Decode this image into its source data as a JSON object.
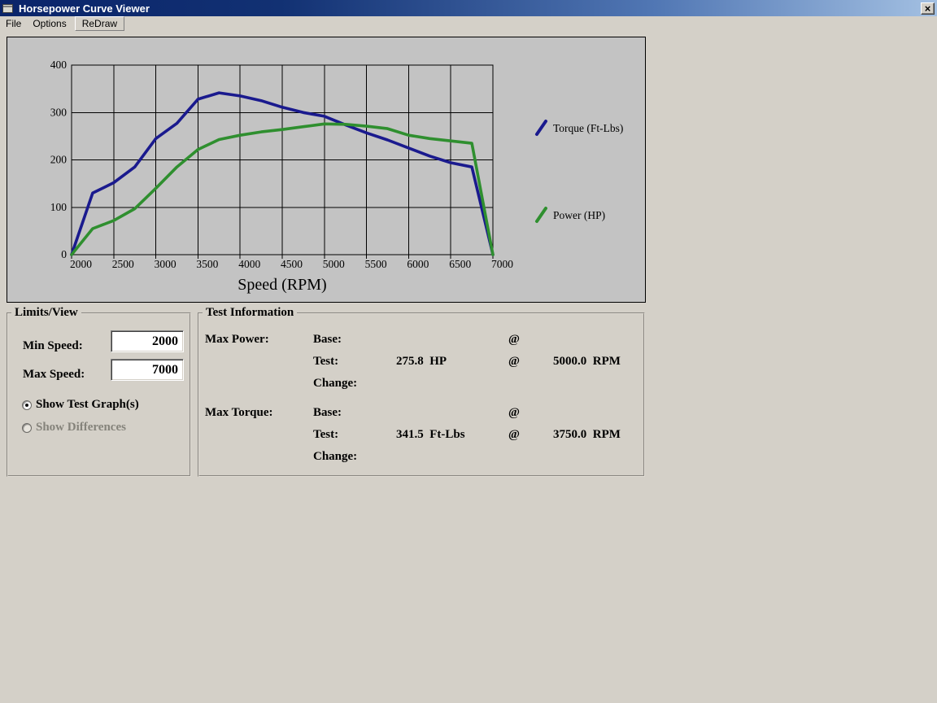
{
  "window": {
    "title": "Horsepower Curve Viewer",
    "close_glyph": "×"
  },
  "menu": {
    "items": [
      {
        "label": "File"
      },
      {
        "label": "Options"
      },
      {
        "label": "ReDraw"
      }
    ]
  },
  "chart_data": {
    "type": "line",
    "title": "",
    "xlabel": "Speed (RPM)",
    "ylabel": "",
    "xlim": [
      2000,
      7000
    ],
    "ylim": [
      0,
      400
    ],
    "x_ticks": [
      2000,
      2500,
      3000,
      3500,
      4000,
      4500,
      5000,
      5500,
      6000,
      6500,
      7000
    ],
    "y_ticks": [
      0,
      100,
      200,
      300,
      400
    ],
    "grid": true,
    "legend_position": "right-of-plot",
    "x": [
      2000,
      2250,
      2500,
      2750,
      3000,
      3250,
      3500,
      3750,
      4000,
      4250,
      4500,
      4750,
      5000,
      5250,
      5500,
      5750,
      6000,
      6250,
      6500,
      6750,
      7000
    ],
    "series": [
      {
        "name": "Torque (Ft-Lbs)",
        "color": "#1a1a8e",
        "values": [
          0,
          130,
          152,
          185,
          245,
          277,
          328,
          341.5,
          335,
          325,
          311,
          300,
          292,
          274,
          257,
          242,
          225,
          208,
          194,
          185,
          0
        ]
      },
      {
        "name": "Power (HP)",
        "color": "#2f8f2f",
        "values": [
          0,
          55,
          72,
          97,
          140,
          185,
          222,
          243,
          252,
          259,
          264,
          270,
          275.8,
          275,
          271,
          266,
          252,
          245,
          240,
          235,
          0
        ]
      }
    ]
  },
  "limits": {
    "title": "Limits/View",
    "min_speed_label": "Min Speed:",
    "min_speed_value": "2000",
    "max_speed_label": "Max Speed:",
    "max_speed_value": "7000",
    "radio_show_test": "Show Test Graph(s)",
    "radio_show_diff": "Show Differences"
  },
  "test_info": {
    "title": "Test Information",
    "max_power_label": "Max Power:",
    "max_torque_label": "Max Torque:",
    "base_label": "Base:",
    "test_label": "Test:",
    "change_label": "Change:",
    "at_symbol": "@",
    "power_test_value": "275.8  HP",
    "power_test_rpm": "5000.0  RPM",
    "torque_test_value": "341.5  Ft-Lbs",
    "torque_test_rpm": "3750.0  RPM"
  }
}
